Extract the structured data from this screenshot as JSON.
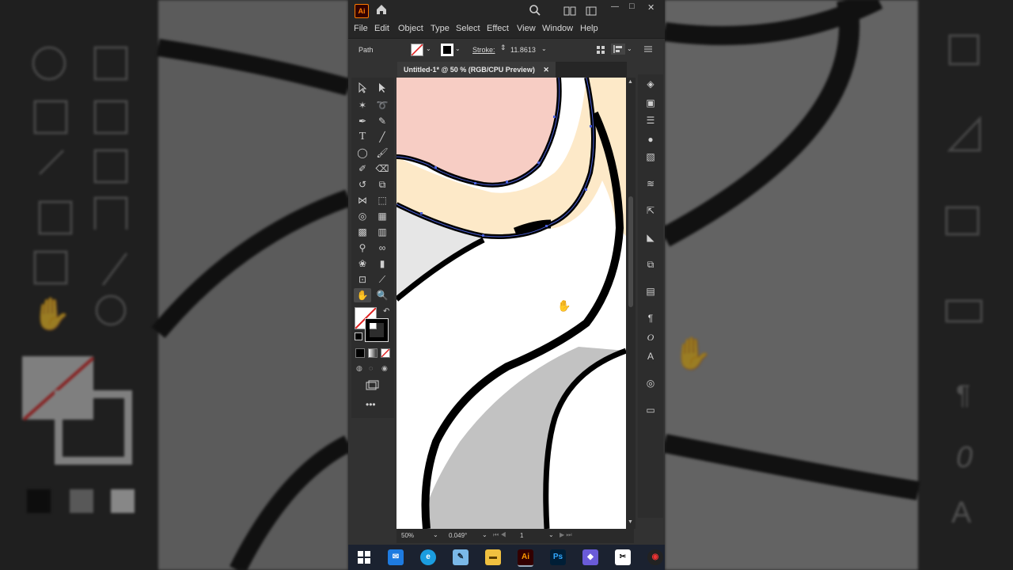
{
  "app": {
    "logo_text": "Ai",
    "menu": [
      "File",
      "Edit",
      "Object",
      "Type",
      "Select",
      "Effect",
      "View",
      "Window",
      "Help"
    ],
    "window_controls": {
      "minimize": "—",
      "maximize": "□",
      "close": "✕"
    }
  },
  "control_bar": {
    "selection_label": "Path",
    "stroke_label": "Stroke:",
    "stroke_value": "11.8613"
  },
  "document_tab": {
    "title": "Untitled-1* @ 50 % (RGB/CPU Preview)",
    "close_glyph": "✕"
  },
  "status_bar": {
    "zoom": "50%",
    "rotation": "0.049°",
    "artboard": "1"
  },
  "colors": {
    "app_bg": "#323232",
    "chrome_dark": "#262626",
    "skin_pink": "#f7cdc4",
    "skin_light": "#fde9c8",
    "gray_fill": "#c2c2c2",
    "light_gray_fill": "#e6e6e6",
    "stroke": "#000000",
    "path_highlight": "#4a5fd8",
    "ai_logo": "#ff7c00"
  },
  "taskbar": {
    "icons": [
      "windows-icon",
      "mail-icon",
      "edge-icon",
      "notepad-icon",
      "file-explorer-icon",
      "illustrator-icon",
      "photoshop-icon",
      "app-icon",
      "capcut-icon",
      "chrome-icon"
    ],
    "illustrator_label": "Ai",
    "photoshop_label": "Ps"
  }
}
